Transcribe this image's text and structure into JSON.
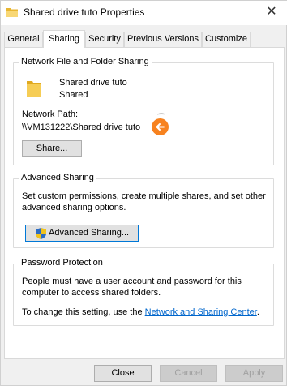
{
  "window": {
    "title": "Shared drive tuto Properties",
    "close_glyph": "✕"
  },
  "tabs": [
    {
      "label": "General"
    },
    {
      "label": "Sharing"
    },
    {
      "label": "Security"
    },
    {
      "label": "Previous Versions"
    },
    {
      "label": "Customize"
    }
  ],
  "network_sharing": {
    "legend": "Network File and Folder Sharing",
    "folder_name": "Shared drive tuto",
    "status": "Shared",
    "path_label": "Network Path:",
    "path_value": "\\\\VM131222\\Shared drive tuto",
    "share_button": "Share..."
  },
  "advanced_sharing": {
    "legend": "Advanced Sharing",
    "description_line1": "Set custom permissions, create multiple shares, and set other",
    "description_line2": "advanced sharing options.",
    "button": "Advanced Sharing..."
  },
  "password_protection": {
    "legend": "Password Protection",
    "line1": "People must have a user account and password for this",
    "line2": "computer to access shared folders.",
    "change_prefix": "To change this setting, use the ",
    "link": "Network and Sharing Center",
    "change_suffix": "."
  },
  "footer": {
    "close": "Close",
    "cancel": "Cancel",
    "apply": "Apply"
  },
  "colors": {
    "accent": "#0078d7",
    "annotation": "#f7821f",
    "folder": "#f4c542"
  }
}
